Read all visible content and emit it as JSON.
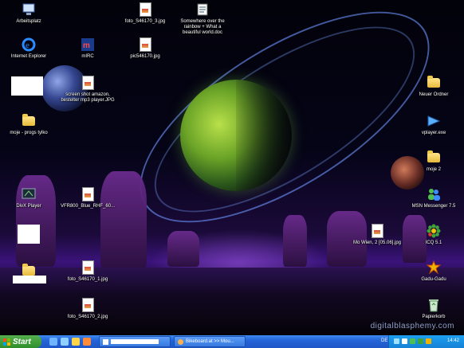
{
  "desktop": {
    "watermark": "digitalblasphemy.com",
    "icons_left": [
      {
        "label": "Arbeitsplatz",
        "icon": "my-computer-icon"
      },
      {
        "label": "Internet Explorer",
        "icon": "internet-explorer-icon"
      },
      {
        "label": "moje - progs tylko",
        "icon": "folder-icon"
      },
      {
        "label": "DivX Player",
        "icon": "divx-player-icon"
      }
    ],
    "icons_mid": [
      {
        "label": "foto_S46170_3.jpg",
        "icon": "jpg-file-icon"
      },
      {
        "label": "mIRC",
        "icon": "mirc-icon"
      },
      {
        "label": "pic546170.jpg",
        "icon": "jpg-file-icon"
      },
      {
        "label": "screen shot amazon, bestelter mp3 player.JPG",
        "icon": "jpg-file-icon"
      },
      {
        "label": "VFR800_Blue_RHF_60...",
        "icon": "jpg-file-icon"
      },
      {
        "label": "foto_S46170_1.jpg",
        "icon": "jpg-file-icon"
      },
      {
        "label": "foto_S46170_2.jpg",
        "icon": "jpg-file-icon"
      }
    ],
    "icon_doc": {
      "label": "Somewhere over the rainbow + What a beautiful world.doc",
      "icon": "word-document-icon"
    },
    "icons_right": [
      {
        "label": "Neuer Ordner",
        "icon": "folder-icon"
      },
      {
        "label": "vplayer.exe",
        "icon": "vplayer-icon"
      },
      {
        "label": "moje 2",
        "icon": "folder-icon"
      },
      {
        "label": "MSN Messenger 7.5",
        "icon": "msn-messenger-icon"
      },
      {
        "label": "ICQ 5.1",
        "icon": "icq-icon"
      },
      {
        "label": "Gadu-Gadu",
        "icon": "gadu-gadu-icon"
      },
      {
        "label": "Papierkorb",
        "icon": "recycle-bin-icon"
      }
    ],
    "icon_wien": {
      "label": "Mo Wien, 2 [05.06].jpg",
      "icon": "jpg-file-icon"
    }
  },
  "taskbar": {
    "start_label": "Start",
    "tasks": [
      {
        "label": "",
        "icon": "window-icon"
      },
      {
        "label": "Bikeboard.at >> Mou...",
        "icon": "browser-icon"
      }
    ],
    "lang": "DE",
    "clock": "14:42"
  },
  "colors": {
    "taskbar": "#2464d8",
    "start": "#2f8f2b",
    "tray": "#1581d6"
  }
}
